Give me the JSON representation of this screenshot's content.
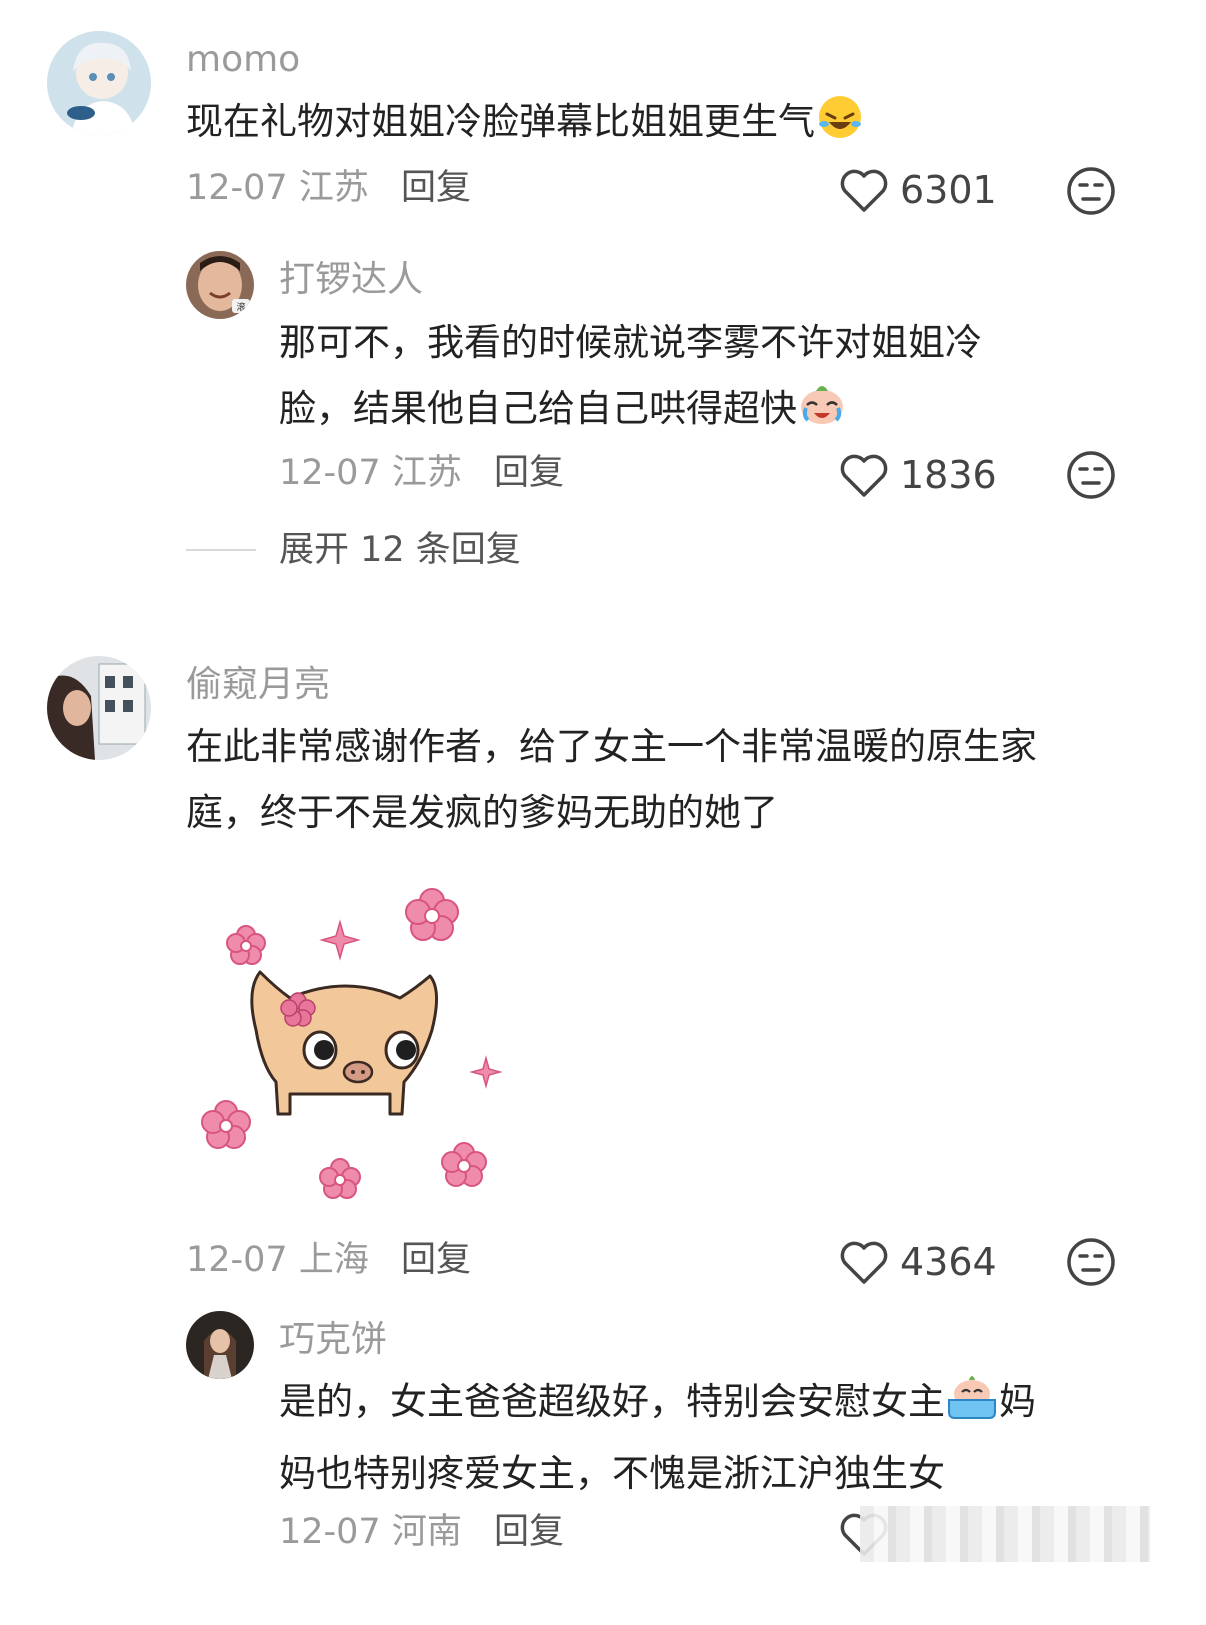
{
  "comments": [
    {
      "username": "momo",
      "text": "现在礼物对姐姐冷脸弹幕比姐姐更生气",
      "date": "12-07",
      "location": "江苏",
      "reply_label": "回复",
      "likes": "6301",
      "replies": [
        {
          "username": "打锣达人",
          "text_line1": "那可不，我看的时候就说李雾不许对姐姐冷",
          "text_line2": "脸，结果他自己给自己哄得超快",
          "date": "12-07",
          "location": "江苏",
          "reply_label": "回复",
          "likes": "1836"
        }
      ],
      "expand_label": "展开 12 条回复"
    },
    {
      "username": "偷窥月亮",
      "text_line1": "在此非常感谢作者，给了女主一个非常温暖的原生家",
      "text_line2": "庭，终于不是发疯的爹妈无助的她了",
      "date": "12-07",
      "location": "上海",
      "reply_label": "回复",
      "likes": "4364",
      "replies": [
        {
          "username": "巧克饼",
          "text_line1": "是的，女主爸爸超级好，特别会安慰女主",
          "text_line1_end": "妈",
          "text_line2": "妈也特别疼爱女主，不愧是浙江沪独生女",
          "date": "12-07",
          "location": "河南",
          "reply_label": "回复"
        }
      ]
    }
  ],
  "avatar_badge": "滚",
  "colors": {
    "pink": "#e8769b",
    "dog": "#f2c79a",
    "gray": "#9a9a9a"
  }
}
